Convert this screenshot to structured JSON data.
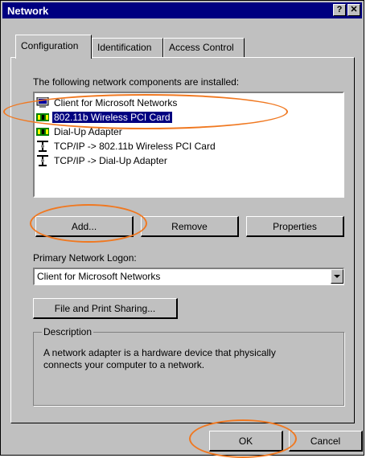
{
  "window": {
    "title": "Network",
    "help_glyph": "?",
    "close_glyph": "✕"
  },
  "tabs": [
    {
      "label": "Configuration",
      "active": true
    },
    {
      "label": "Identification",
      "active": false
    },
    {
      "label": "Access Control",
      "active": false
    }
  ],
  "components": {
    "heading": "The following network components are installed:",
    "items": [
      {
        "label": "Client for Microsoft Networks",
        "icon": "network-client-icon",
        "selected": false
      },
      {
        "label": "802.11b Wireless PCI Card",
        "icon": "network-card-icon",
        "selected": true
      },
      {
        "label": "Dial-Up Adapter",
        "icon": "network-card-icon",
        "selected": false
      },
      {
        "label": "TCP/IP -> 802.11b Wireless PCI Card",
        "icon": "protocol-icon",
        "selected": false
      },
      {
        "label": "TCP/IP -> Dial-Up Adapter",
        "icon": "protocol-icon",
        "selected": false
      }
    ]
  },
  "buttons": {
    "add": "Add...",
    "remove": "Remove",
    "properties": "Properties",
    "file_print": "File and Print Sharing...",
    "ok": "OK",
    "cancel": "Cancel"
  },
  "logon": {
    "label": "Primary Network Logon:",
    "value": "Client for Microsoft Networks"
  },
  "description": {
    "title": "Description",
    "text": "A network adapter is a hardware device that physically connects your computer to a network."
  },
  "colors": {
    "titlebar": "#000080",
    "face": "#c0c0c0",
    "selection": "#000080",
    "annotation": "#f07820"
  }
}
